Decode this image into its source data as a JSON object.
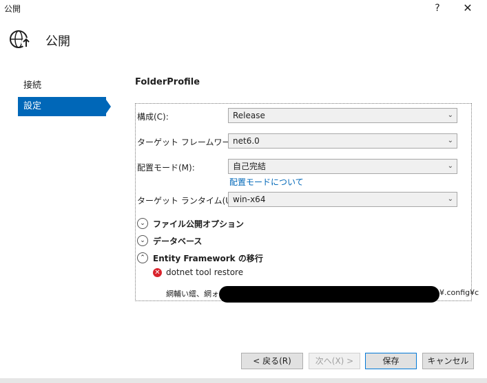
{
  "window": {
    "title": "公開",
    "help": "?",
    "close": "✕"
  },
  "header": {
    "title": "公開",
    "icon": "globe-publish-icon"
  },
  "sidebar": {
    "items": [
      {
        "label": "接続"
      },
      {
        "label": "設定"
      }
    ]
  },
  "profile": {
    "name": "FolderProfile"
  },
  "settings": {
    "configuration": {
      "label": "構成(C):",
      "value": "Release"
    },
    "framework": {
      "label": "ターゲット フレームワーク(F):",
      "value": "net6.0"
    },
    "deploy_mode": {
      "label": "配置モード(M):",
      "value": "自己完結",
      "link": "配置モードについて"
    },
    "runtime": {
      "label": "ターゲット ランタイム(U):",
      "value": "win-x64"
    }
  },
  "sections": [
    {
      "label": "ファイル公開オプション",
      "state": "collapsed"
    },
    {
      "label": "データベース",
      "state": "collapsed"
    },
    {
      "label": "Entity Framework の移行",
      "state": "expanded"
    }
  ],
  "migration": {
    "error_text": "dotnet tool restore",
    "path_prefix": "網輔い繧、網ォ C:",
    "path_suffix": "¥.config¥c"
  },
  "buttons": {
    "back": "< 戻る(R)",
    "next": "次へ(X) >",
    "save": "保存",
    "cancel": "キャンセル"
  },
  "colors": {
    "accent": "#0067b8",
    "error": "#d9232c"
  }
}
